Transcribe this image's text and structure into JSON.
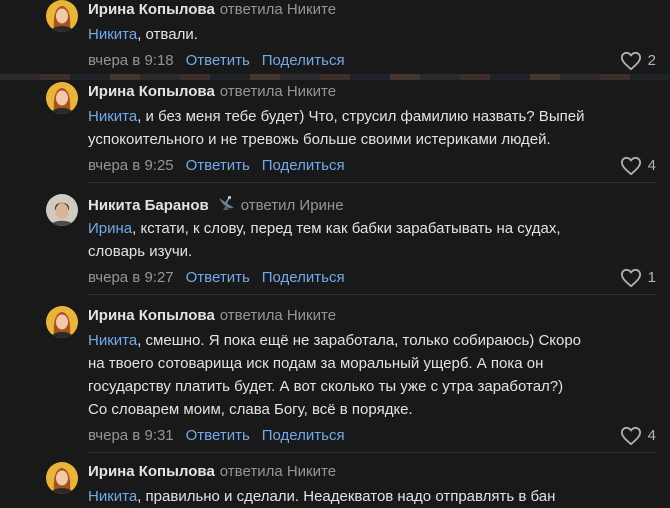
{
  "comments": [
    {
      "author": "Ирина Копылова",
      "reply_to": "ответила Никите",
      "mention": "Никита",
      "lines": [
        ", отвали."
      ],
      "time": "вчера в 9:18",
      "reply_label": "Ответить",
      "share_label": "Поделиться",
      "likes": "2"
    },
    {
      "author": "Ирина Копылова",
      "reply_to": "ответила Никите",
      "mention": "Никита",
      "lines": [
        ", и без меня тебе будет) Что, струсил фамилию назвать? Выпей",
        "успокоительного и не тревожь больше своими истериками людей."
      ],
      "time": "вчера в 9:25",
      "reply_label": "Ответить",
      "share_label": "Поделиться",
      "likes": "4"
    },
    {
      "author": "Никита Баранов",
      "reply_to": "ответил Ирине",
      "mention": "Ирина",
      "lines": [
        ", кстати, к слову, перед тем как бабки зарабатывать на судах,",
        "словарь изучи."
      ],
      "time": "вчера в 9:27",
      "reply_label": "Ответить",
      "share_label": "Поделиться",
      "likes": "1"
    },
    {
      "author": "Ирина Копылова",
      "reply_to": "ответила Никите",
      "mention": "Никита",
      "lines": [
        ", смешно. Я пока ещё не заработала, только собираюсь) Скоро",
        "на твоего сотоварища иск подам за моральный ущерб. А пока он",
        "государству платить будет. А вот сколько ты уже с утра заработал?)",
        "Со словарем моим, слава Богу, всё в порядке."
      ],
      "time": "вчера в 9:31",
      "reply_label": "Ответить",
      "share_label": "Поделиться",
      "likes": "4"
    },
    {
      "author": "Ирина Копылова",
      "reply_to": "ответила Никите",
      "mention": "Никита",
      "lines": [
        ", правильно и сделали. Неадекватов надо отправлять в бан"
      ]
    }
  ],
  "colors": {
    "background": "#19191a",
    "link": "#71aaeb",
    "secondary": "#939699",
    "text": "#e1e3e6"
  },
  "icons": {
    "like": "heart-icon",
    "badge": "satellite-dish-icon"
  }
}
